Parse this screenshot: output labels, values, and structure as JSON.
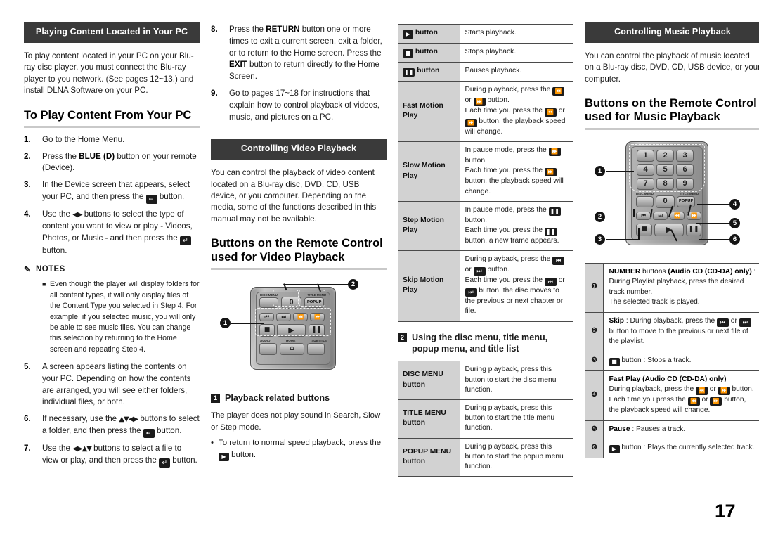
{
  "page": {
    "number": "17"
  },
  "col1": {
    "section_title": "Playing Content Located in Your PC",
    "intro": "To play content located in your PC on your Blu-ray disc player, you must connect the Blu-ray player to you network. (See pages 12~13.) and install DLNA Software on your PC.",
    "heading": "To Play Content From Your PC",
    "steps": [
      {
        "num": "1.",
        "text": "Go to the Home Menu."
      },
      {
        "num": "2.",
        "text": "Press the BLUE (D) button on your remote (Device)."
      },
      {
        "num": "3.",
        "text": "In the Device screen that appears, select your PC, and then press the  button."
      },
      {
        "num": "4.",
        "text": "Use the  buttons to select the type of content you want to view or play - Videos, Photos, or Music - and then press the  button."
      },
      {
        "num": "5.",
        "text": "A screen appears listing the contents on your PC. Depending on how the contents are arranged, you will see either folders, individual files, or both."
      },
      {
        "num": "6.",
        "text": "If necessary, use the  buttons to select a folder, and then press the  button."
      },
      {
        "num": "7.",
        "text": "Use the  buttons to select a file to view or play, and then press the  button."
      }
    ],
    "notes_label": "NOTES",
    "note_1": "Even though the player will display folders for all content types, it will only display files of the Content Type you selected in Step 4. For example, if you selected music, you will only be able to see music files. You can change this selection by returning to the Home screen and repeating Step 4."
  },
  "col2": {
    "steps": [
      {
        "num": "8.",
        "text": "Press the RETURN button one or more times to exit a current screen, exit a folder, or to return to the Home screen. Press the EXIT button to return directly to the Home Screen."
      },
      {
        "num": "9.",
        "text": "Go to pages 17~18 for instructions that explain how to control playback of videos, music, and pictures on a PC."
      }
    ],
    "section_title": "Controlling Video Playback",
    "intro": "You can control the playback of video content located on a Blu-ray disc, DVD, CD, USB device, or you computer. Depending on the media, some of the functions described in this manual may not be available.",
    "heading": "Buttons on the Remote Control used for Video Playback",
    "callout_1": "1",
    "callout_2": "2",
    "sub_head_1": "Playback related buttons",
    "note_a": "The player does not play sound in Search, Slow or Step mode.",
    "note_b": "To return to normal speed playback, press the  button.",
    "remote_labels": {
      "disc_menu": "DISC MENU",
      "title_menu": "TITLE MENU",
      "zero": "0",
      "popup": "POPUP",
      "audio": "AUDIO",
      "home": "HOME",
      "subtitle": "SUBTITLE"
    }
  },
  "col3": {
    "table": [
      {
        "label": "▶ button",
        "label_icon": "play",
        "desc": "Starts playback."
      },
      {
        "label": "■ button",
        "label_icon": "stop",
        "desc": "Stops playback."
      },
      {
        "label": "❙❙ button",
        "label_icon": "pause",
        "desc": "Pauses playback."
      },
      {
        "label": "Fast Motion Play",
        "label_icon": "",
        "desc": "During playback, press the  or  button. Each time you press the  or  button, the playback speed will change."
      },
      {
        "label": "Slow Motion Play",
        "label_icon": "",
        "desc": "In pause mode, press the  button. Each time you press the  button, the playback speed will change."
      },
      {
        "label": "Step Motion Play",
        "label_icon": "",
        "desc": "In pause mode, press the  button. Each time you press the  button, a new frame appears."
      },
      {
        "label": "Skip Motion Play",
        "label_icon": "",
        "desc": "During playback, press the  or  button. Each time you press the  or  button, the disc moves to the previous or next chapter or file."
      }
    ],
    "sub_head_2": "Using the disc menu, title menu, popup menu, and title list",
    "menu_table": [
      {
        "label": "DISC MENU button",
        "desc": "During playback, press this button to start the disc menu function."
      },
      {
        "label": "TITLE MENU button",
        "desc": "During playback, press this button to start the title menu function."
      },
      {
        "label": "POPUP MENU button",
        "desc": "During playback, press this button to start the popup menu function."
      }
    ]
  },
  "col4": {
    "section_title": "Controlling Music Playback",
    "intro": "You can control the playback of music located on a Blu-ray disc, DVD, CD, USB device, or your computer.",
    "heading": "Buttons on the Remote Control used for Music Playback",
    "remote_keys": [
      "1",
      "2",
      "3",
      "4",
      "5",
      "6",
      "7",
      "8",
      "9",
      "0"
    ],
    "remote_popup": "POPUP",
    "callouts": [
      "1",
      "2",
      "3",
      "4",
      "5",
      "6"
    ],
    "list": [
      {
        "num": "❶",
        "title": "NUMBER buttons (Audio CD (CD-DA) only) :",
        "desc": "During Playlist playback, press the desired track number. The selected track is played."
      },
      {
        "num": "❷",
        "title": "Skip :",
        "desc": "During playback, press the  or  button to move to the previous or next file of the playlist."
      },
      {
        "num": "❸",
        "title": "",
        "desc": " button : Stops a track."
      },
      {
        "num": "❹",
        "title": "Fast Play (Audio CD (CD-DA) only)",
        "desc": "During playback, press the  or  button. Each time you press the  or  button, the playback speed will change."
      },
      {
        "num": "❺",
        "title": "Pause :",
        "desc": "Pauses a track."
      },
      {
        "num": "❻",
        "title": "",
        "desc": " button : Plays the currently selected track."
      }
    ]
  }
}
